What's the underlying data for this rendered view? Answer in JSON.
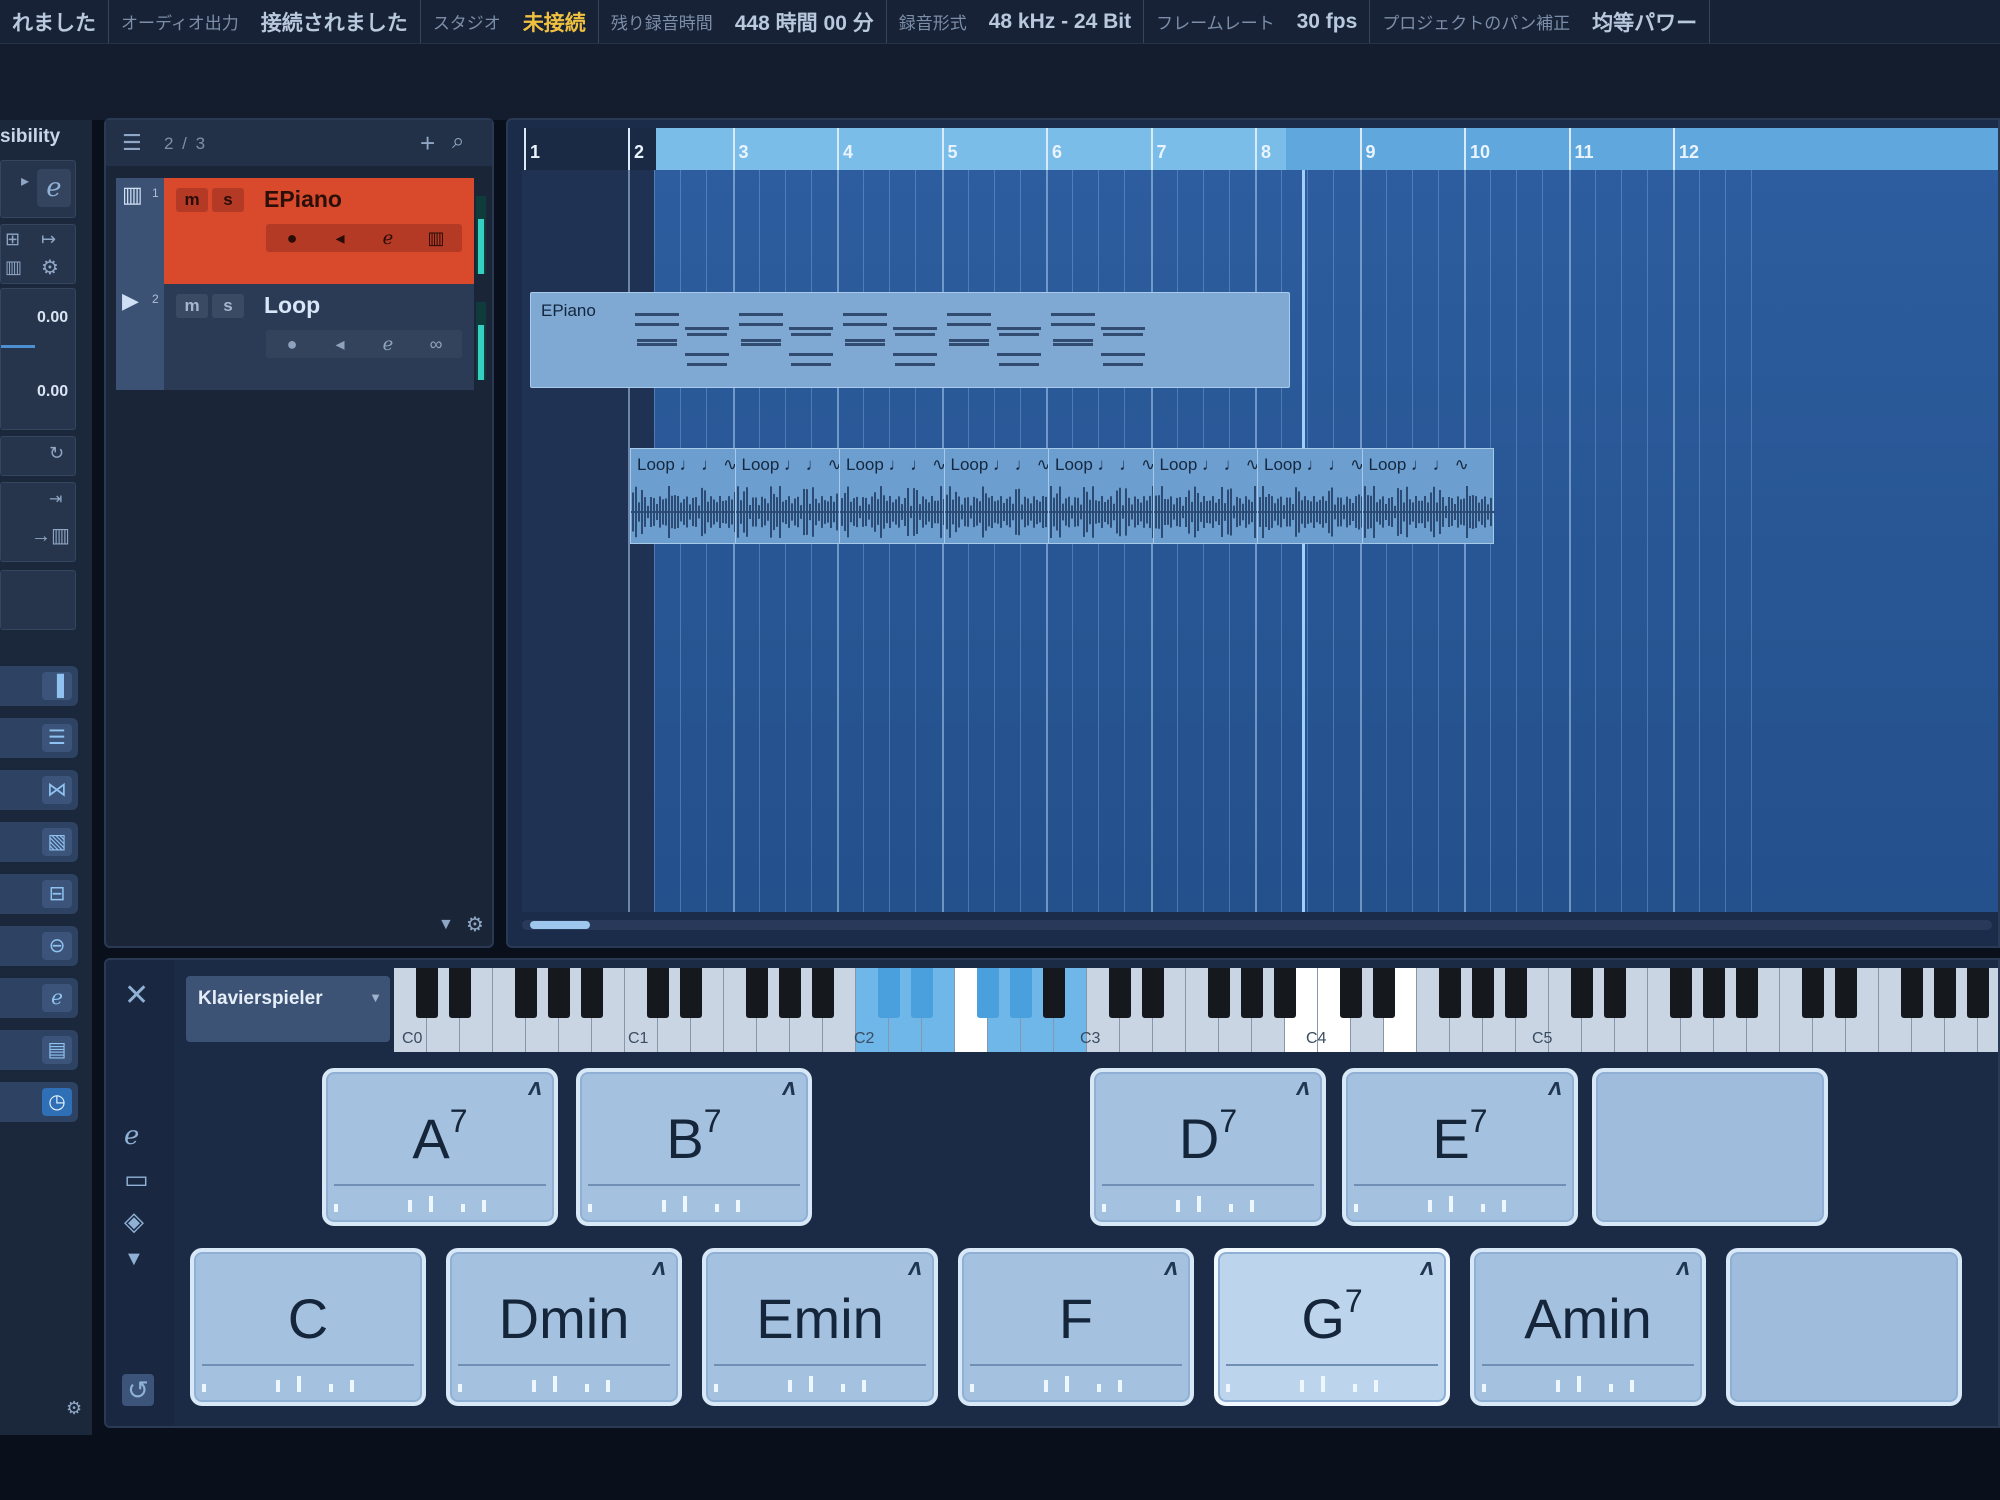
{
  "status_bar": [
    {
      "label": "",
      "value": "れました"
    },
    {
      "label": "オーディオ出力",
      "value": "接続されました"
    },
    {
      "label": "スタジオ",
      "value": "未接続"
    },
    {
      "label": "残り録音時間",
      "value": "448 時間 00 分"
    },
    {
      "label": "録音形式",
      "value": "48 kHz - 24 Bit"
    },
    {
      "label": "フレームレート",
      "value": "30 fps"
    },
    {
      "label": "プロジェクトのパン補正",
      "value": "均等パワー"
    }
  ],
  "inspector": {
    "title": "sibility",
    "value1": "0.00",
    "value2": "0.00"
  },
  "track_list": {
    "count": "2 / 3",
    "tracks": [
      {
        "number": "1",
        "name": "EPiano",
        "mute": "m",
        "solo": "s",
        "color": "#d94a2c"
      },
      {
        "number": "2",
        "name": "Loop",
        "mute": "m",
        "solo": "s",
        "color": "#2b3b56"
      }
    ]
  },
  "arrange": {
    "bars": [
      "1",
      "2",
      "3",
      "4",
      "5",
      "6",
      "7",
      "8",
      "9",
      "10",
      "11",
      "12"
    ],
    "midi_event_label": "EPiano",
    "audio_event_label": "Loop",
    "audio_event_count": 8
  },
  "chord_pads": {
    "player": "Klavierspieler",
    "octave_labels": [
      "C0",
      "C1",
      "C2",
      "C3",
      "C4",
      "C5"
    ],
    "voicing_symbol": "ᐱ",
    "top_row": [
      {
        "root": "A",
        "ext": "7"
      },
      {
        "root": "B",
        "ext": "7"
      },
      {
        "root": "D",
        "ext": "7"
      },
      {
        "root": "E",
        "ext": "7"
      },
      {
        "root": "",
        "ext": ""
      }
    ],
    "bottom_row": [
      {
        "root": "C",
        "ext": ""
      },
      {
        "root": "Dmin",
        "ext": ""
      },
      {
        "root": "Emin",
        "ext": ""
      },
      {
        "root": "F",
        "ext": ""
      },
      {
        "root": "G",
        "ext": "7"
      },
      {
        "root": "Amin",
        "ext": ""
      },
      {
        "root": "",
        "ext": ""
      }
    ]
  },
  "colors": {
    "accent": "#5fa7dc",
    "track_selected": "#d94a2c",
    "warning_text": "#f0c040"
  }
}
